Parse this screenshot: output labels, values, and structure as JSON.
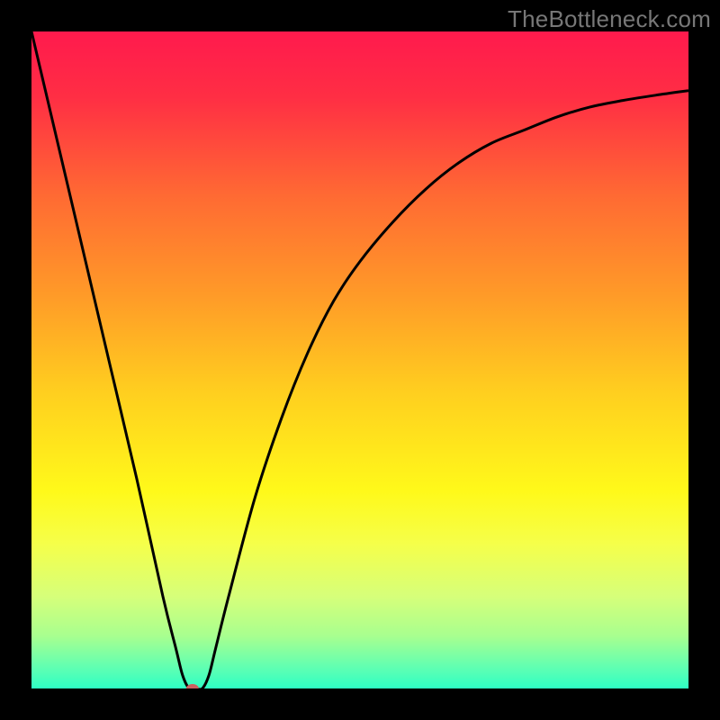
{
  "watermark": "TheBottleneck.com",
  "chart_data": {
    "type": "line",
    "title": "",
    "xlabel": "",
    "ylabel": "",
    "xlim": [
      0,
      100
    ],
    "ylim": [
      0,
      100
    ],
    "x": [
      0,
      4,
      8,
      12,
      16,
      20,
      22,
      23,
      24,
      25,
      26,
      27,
      28,
      30,
      34,
      38,
      42,
      46,
      50,
      55,
      60,
      65,
      70,
      75,
      80,
      85,
      90,
      95,
      100
    ],
    "values": [
      100,
      83,
      66,
      49,
      32,
      14,
      6,
      2,
      0,
      0,
      0,
      2,
      6,
      14,
      29,
      41,
      51,
      59,
      65,
      71,
      76,
      80,
      83,
      85,
      87,
      88.5,
      89.5,
      90.3,
      91
    ],
    "marker": {
      "x": 24.5,
      "y": 0,
      "color": "#cc6060",
      "radius": 6
    },
    "background_gradient": {
      "type": "vertical",
      "stops": [
        {
          "offset": 0.0,
          "color": "#ff1a4d"
        },
        {
          "offset": 0.1,
          "color": "#ff2e44"
        },
        {
          "offset": 0.25,
          "color": "#ff6a33"
        },
        {
          "offset": 0.4,
          "color": "#ff9a28"
        },
        {
          "offset": 0.55,
          "color": "#ffcf1f"
        },
        {
          "offset": 0.7,
          "color": "#fff91a"
        },
        {
          "offset": 0.78,
          "color": "#f5ff4a"
        },
        {
          "offset": 0.86,
          "color": "#d6ff7a"
        },
        {
          "offset": 0.92,
          "color": "#a8ff8f"
        },
        {
          "offset": 0.97,
          "color": "#5dffb3"
        },
        {
          "offset": 1.0,
          "color": "#2effc4"
        }
      ]
    },
    "curve_color": "#000000",
    "curve_width": 3
  }
}
